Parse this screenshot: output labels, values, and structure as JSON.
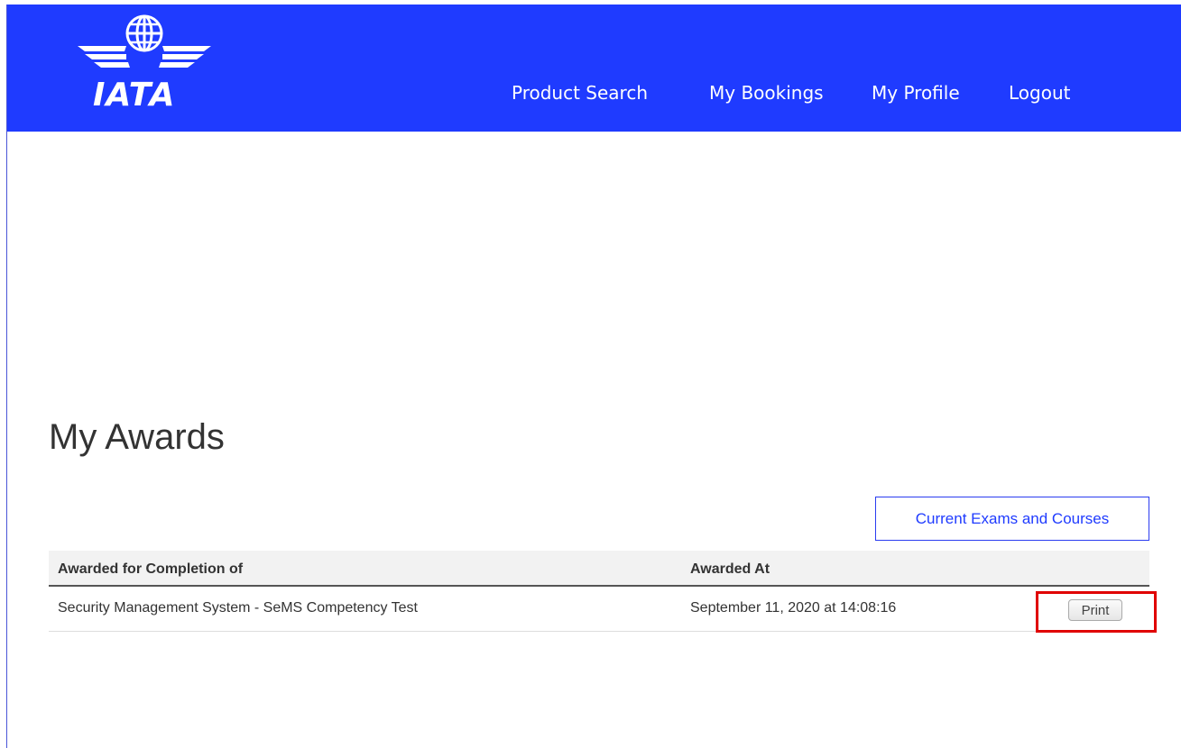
{
  "header": {
    "logo_text": "IATA",
    "nav": [
      "Product Search",
      "My Bookings",
      "My Profile",
      "Logout"
    ]
  },
  "page": {
    "title": "My Awards",
    "current_button": "Current Exams and Courses"
  },
  "table": {
    "columns": [
      "Awarded for Completion of",
      "Awarded At"
    ],
    "rows": [
      {
        "completion": "Security Management System - SeMS Competency Test",
        "awarded_at": "September 11, 2020 at 14:08:16",
        "action": "Print"
      }
    ]
  },
  "colors": {
    "header_bg": "#1f3bff",
    "highlight": "#e00000"
  },
  "icons": {
    "logo": "iata-globe-wings-icon"
  }
}
